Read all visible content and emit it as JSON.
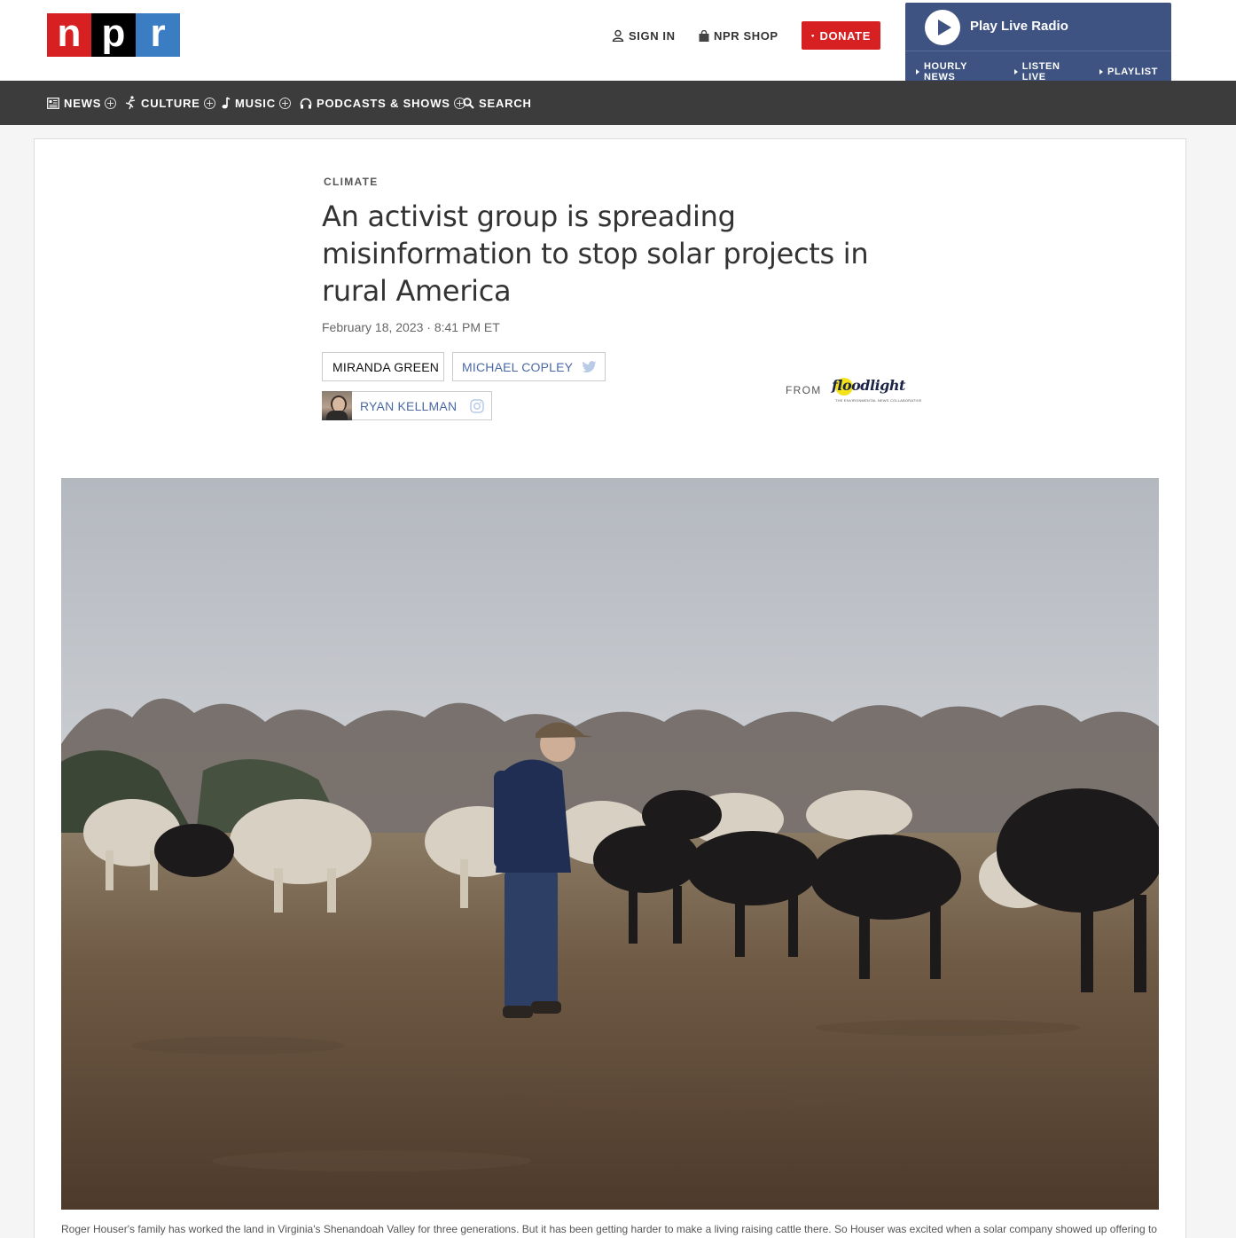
{
  "logo": {
    "letters": [
      "n",
      "p",
      "r"
    ],
    "colors": [
      "#d62021",
      "#000000",
      "#3a7dc2"
    ]
  },
  "utility": {
    "sign_in": "SIGN IN",
    "shop": "NPR SHOP",
    "donate": "DONATE"
  },
  "radio": {
    "play_label": "Play Live Radio",
    "links": [
      "HOURLY NEWS",
      "LISTEN LIVE",
      "PLAYLIST"
    ]
  },
  "nav": {
    "items": [
      {
        "label": "NEWS",
        "icon": "news-icon"
      },
      {
        "label": "CULTURE",
        "icon": "culture-icon"
      },
      {
        "label": "MUSIC",
        "icon": "music-note-icon"
      },
      {
        "label": "PODCASTS & SHOWS",
        "icon": "headphones-icon"
      },
      {
        "label": "SEARCH",
        "icon": "search-icon"
      }
    ]
  },
  "article": {
    "section": "CLIMATE",
    "headline": "An activist group is spreading misinformation to stop solar projects in rural America",
    "date": "February 18, 2023 · 8:41 PM ET",
    "bylines": [
      "MIRANDA GREEN",
      "MICHAEL COPLEY",
      "RYAN KELLMAN"
    ],
    "from_label": "FROM",
    "partner": {
      "name": "floodlight",
      "tagline": "THE ENVIRONMENTAL NEWS COLLABORATIVE"
    },
    "caption": "Roger Houser's family has worked the land in Virginia's Shenandoah Valley for three generations. But it has been getting harder to make a living raising cattle there. So Houser was excited when a solar company showed up offering to"
  },
  "colors": {
    "nav_bg": "#3c3c3c",
    "radio_bg": "#3e5382",
    "accent_red": "#d62021",
    "link_blue": "#4b6aa5"
  }
}
